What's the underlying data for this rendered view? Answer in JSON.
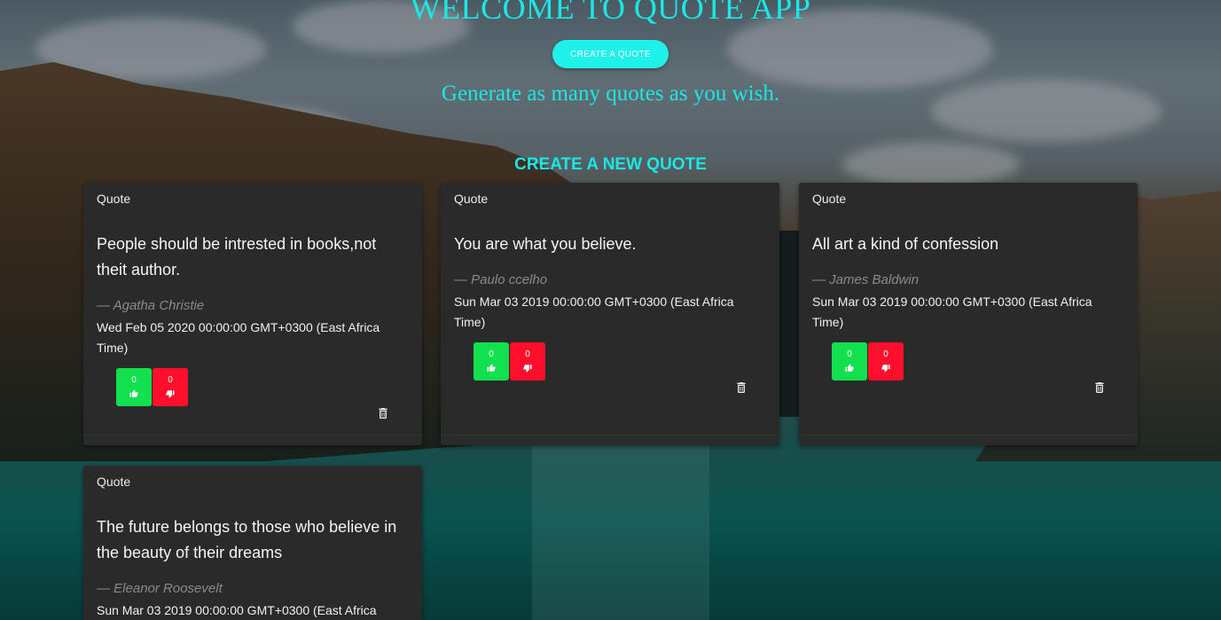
{
  "header": {
    "title": "WELCOME TO QUOTE APP",
    "create_button": "CREATE A QUOTE",
    "tagline": "Generate as many quotes as you wish.",
    "section_title": "CREATE A NEW QUOTE"
  },
  "colors": {
    "accent": "#19e8e5",
    "upvote": "#12e04f",
    "downvote": "#ff0f2c",
    "card": "#2a2a2a"
  },
  "quotes": [
    {
      "label": "Quote",
      "text": "People should be intrested in books,not theit author.",
      "author": "— Agatha Christie",
      "date": "Wed Feb 05 2020 00:00:00 GMT+0300 (East Africa Time)",
      "upvotes": "0",
      "downvotes": "0"
    },
    {
      "label": "Quote",
      "text": "You are what you believe.",
      "author": "— Paulo ccelho",
      "date": "Sun Mar 03 2019 00:00:00 GMT+0300 (East Africa Time)",
      "upvotes": "0",
      "downvotes": "0"
    },
    {
      "label": "Quote",
      "text": "All art a kind of confession",
      "author": "— James Baldwin",
      "date": "Sun Mar 03 2019 00:00:00 GMT+0300 (East Africa Time)",
      "upvotes": "0",
      "downvotes": "0"
    },
    {
      "label": "Quote",
      "text": "The future belongs to those who believe in the beauty of their dreams",
      "author": "— Eleanor Roosevelt",
      "date": "Sun Mar 03 2019 00:00:00 GMT+0300 (East Africa",
      "upvotes": "",
      "downvotes": ""
    }
  ],
  "icons": {
    "upvote": "thumbs-up-icon",
    "downvote": "thumbs-down-icon",
    "delete": "trash-icon"
  }
}
